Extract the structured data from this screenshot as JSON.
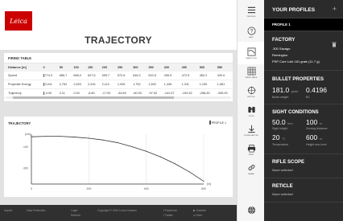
{
  "header": {
    "logo_text": "Leica",
    "title": "TRAJECTORY"
  },
  "firing_table": {
    "title": "FIRING TABLE",
    "columns": [
      "Distance [m]",
      "0",
      "50",
      "100",
      "150",
      "200",
      "250",
      "300",
      "350",
      "400",
      "450",
      "500",
      "550",
      "600"
    ],
    "rows": [
      {
        "label": "Speed",
        "values": [
          "774.0",
          "685.7",
          "656.0",
          "627.6",
          "599.7",
          "572.6",
          "546.2",
          "520.5",
          "495.9",
          "472.5",
          "450.2",
          "429.0",
          "409"
        ]
      },
      {
        "label": "Projectile Energy",
        "values": [
          "3,011",
          "2,762",
          "2,520",
          "2,316",
          "2,110",
          "1,926",
          "1,752",
          "1,592",
          "1,445",
          "1,311",
          "1,190",
          "1,081",
          "983"
        ]
      },
      {
        "label": "Trajectory",
        "values": [
          "-4.00",
          "0.11",
          "0.00",
          "-6.80",
          "-17.92",
          "-34.69",
          "-60.00",
          "-97.52",
          "-141.07",
          "-194.52",
          "-258.82",
          "-335.00",
          "-424"
        ]
      }
    ]
  },
  "trajectory": {
    "title": "TRAJECTORY",
    "legend_label": "PROFILE 1"
  },
  "chart_data": {
    "type": "line",
    "title": "TRAJECTORY",
    "xlabel": "[m]",
    "ylabel": "[cm]",
    "xlim": [
      0,
      600
    ],
    "ylim": [
      -450,
      20
    ],
    "x_ticks": [
      "0",
      "200",
      "400",
      "600"
    ],
    "y_ticks": [
      "-100",
      "-300"
    ],
    "grid": "vertical",
    "series": [
      {
        "name": "PROFILE 1",
        "x": [
          0,
          50,
          100,
          150,
          200,
          250,
          300,
          350,
          400,
          450,
          500,
          550,
          600
        ],
        "y": [
          -4.0,
          0.11,
          0.0,
          -6.8,
          -17.92,
          -34.69,
          -60.0,
          -97.52,
          -141.07,
          -194.52,
          -258.82,
          -335.0,
          -424
        ]
      }
    ]
  },
  "footer": {
    "items": [
      "Imprint",
      "Data Protection",
      "Login",
      "Refresh",
      "Copyright © 2014 Leica Camera",
      "Facebook",
      "Twitter",
      "Youtube",
      "Flickr"
    ]
  },
  "nav": {
    "items": [
      {
        "label": "PROFILES",
        "icon": "menu-icon"
      },
      {
        "label": "HELP",
        "icon": "help-icon"
      },
      {
        "label": "TRAJECTORY",
        "icon": "trajectory-icon"
      },
      {
        "label": "FIRING TABLE",
        "icon": "grid-icon"
      },
      {
        "label": "RETICLE",
        "icon": "crosshair-icon"
      },
      {
        "label": "ZOOM",
        "icon": "binoculars-icon"
      },
      {
        "label": "DOWNLOAD PDF",
        "icon": "download-icon"
      },
      {
        "label": "PRINT",
        "icon": "print-icon"
      },
      {
        "label": "SHARE",
        "icon": "link-icon"
      },
      {
        "label": "",
        "icon": "globe-icon"
      }
    ]
  },
  "side": {
    "title": "YOUR PROFILES",
    "add": "+",
    "profile_name": "PROFILE 1",
    "factory": {
      "heading": "FACTORY",
      "caliber": ".300 Savage",
      "brand": "Remington",
      "bullet": "PSP Core Lokt 181 grain (11.7 g)"
    },
    "bullet_properties": {
      "heading": "BULLET PROPERTIES",
      "weight_value": "181.0",
      "weight_unit": "grain",
      "bc_value": "0.4196",
      "weight_label": "Bullet weight",
      "bc_label": "BC"
    },
    "sight": {
      "heading": "SIGHT CONDITIONS",
      "height_value": "50.0",
      "height_unit": "mm",
      "zero_value": "100",
      "zero_unit": "m",
      "height_label": "Sight height",
      "zero_label": "Zeroing distance",
      "temp_value": "20",
      "temp_unit": "°C",
      "sea_value": "600",
      "sea_unit": "m",
      "temp_label": "Temperature",
      "sea_label": "Height sea level"
    },
    "rifle_scope": {
      "heading": "RIFLE SCOPE",
      "value": "None selected"
    },
    "reticle": {
      "heading": "RETICLE",
      "value": "None selected"
    }
  }
}
